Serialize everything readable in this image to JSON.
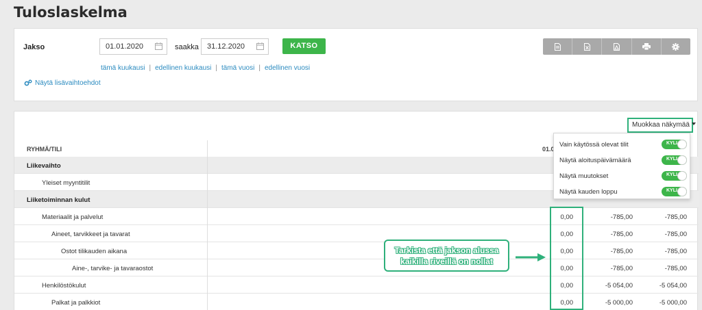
{
  "title": "Tuloslaskelma",
  "filter": {
    "period_label": "Jakso",
    "start_date": "01.01.2020",
    "until_label": "saakka",
    "end_date": "31.12.2020",
    "katso_label": "KATSO",
    "quick_links": [
      "tämä kuukausi",
      "edellinen kuukausi",
      "tämä vuosi",
      "edellinen vuosi"
    ],
    "more_options": "Näytä lisävaihtoehdot",
    "toolbar_icons": [
      "document-icon",
      "excel-icon",
      "pdf-icon",
      "print-icon",
      "gear-icon"
    ]
  },
  "report": {
    "customize_label": "Muokkaa näkymää",
    "columns": {
      "group": "RYHMÄ/TILI",
      "period": "01.0"
    },
    "rows": [
      {
        "name": "Liikevaihto",
        "level": 0,
        "group": true,
        "v1": "",
        "v2": "",
        "v3": ""
      },
      {
        "name": "Yleiset myyntitilit",
        "level": 1,
        "group": false,
        "v1": "",
        "v2": "",
        "v3": ""
      },
      {
        "name": "Liiketoiminnan kulut",
        "level": 0,
        "group": true,
        "v1": "",
        "v2": "",
        "v3": ""
      },
      {
        "name": "Materiaalit ja palvelut",
        "level": 1,
        "group": false,
        "v1": "0,00",
        "v2": "-785,00",
        "v3": "-785,00"
      },
      {
        "name": "Aineet, tarvikkeet ja tavarat",
        "level": 2,
        "group": false,
        "v1": "0,00",
        "v2": "-785,00",
        "v3": "-785,00"
      },
      {
        "name": "Ostot tilikauden aikana",
        "level": 3,
        "group": false,
        "v1": "0,00",
        "v2": "-785,00",
        "v3": "-785,00"
      },
      {
        "name": "Aine-, tarvike- ja tavaraostot",
        "level": 4,
        "group": false,
        "v1": "0,00",
        "v2": "-785,00",
        "v3": "-785,00"
      },
      {
        "name": "Henkilöstökulut",
        "level": 1,
        "group": false,
        "v1": "0,00",
        "v2": "-5 054,00",
        "v3": "-5 054,00"
      },
      {
        "name": "Palkat ja palkkiot",
        "level": 2,
        "group": false,
        "v1": "0,00",
        "v2": "-5 000,00",
        "v3": "-5 000,00"
      }
    ]
  },
  "dropdown": {
    "items": [
      {
        "label": "Vain käytössä olevat tilit",
        "toggle": "KYLL"
      },
      {
        "label": "Näytä aloituspäivämäärä",
        "toggle": "KYLL"
      },
      {
        "label": "Näytä muutokset",
        "toggle": "KYLL"
      },
      {
        "label": "Näytä kauden loppu",
        "toggle": "KYLL"
      }
    ]
  },
  "annotation": {
    "line1": "Tarkista että jakson alussa",
    "line2": "kaikilla riveillä on nollat"
  },
  "colors": {
    "accent_green": "#3db54a",
    "highlight_green": "#2eb07a",
    "link_blue": "#2a8abf",
    "toolbar_gray": "#a9a9a9"
  }
}
